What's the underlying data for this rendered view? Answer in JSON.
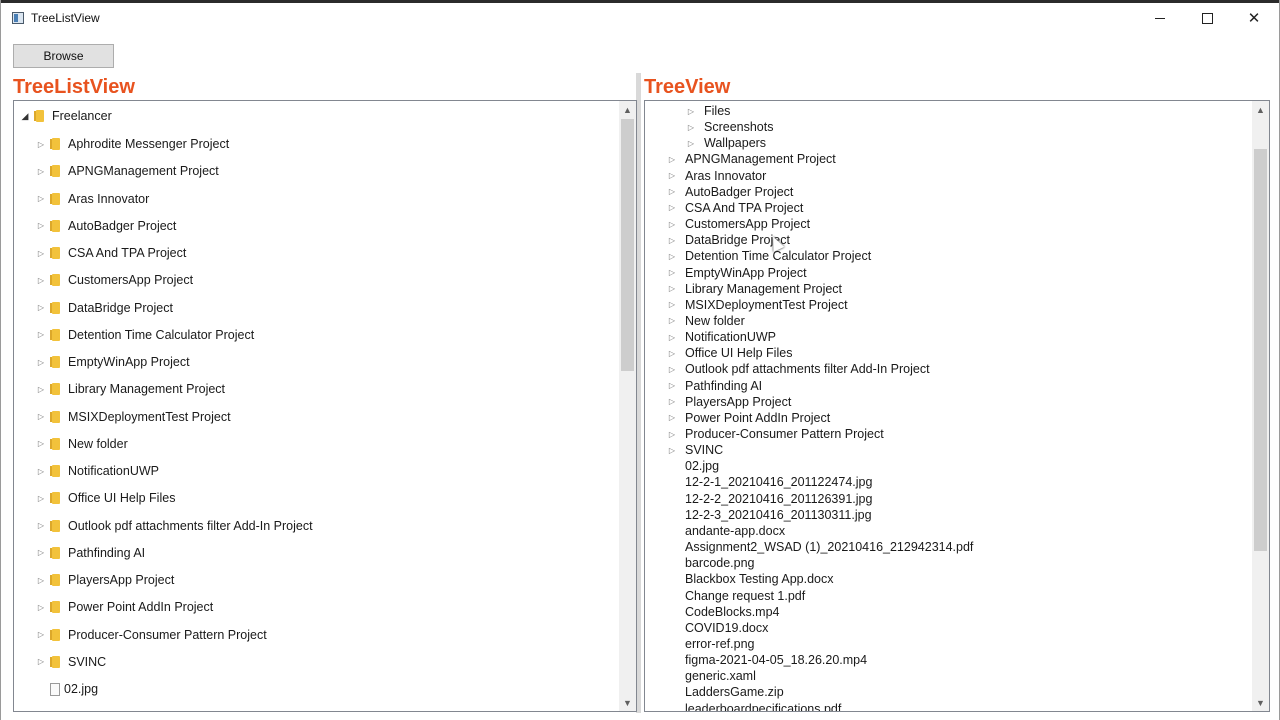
{
  "window": {
    "title": "TreeListView",
    "minimize": "—",
    "maximize": "☐",
    "close": "✕"
  },
  "toolbar": {
    "browse_label": "Browse"
  },
  "left_panel": {
    "heading": "TreeListView",
    "root": "Freelancer",
    "items": [
      {
        "label": "Aphrodite Messenger Project",
        "type": "folder"
      },
      {
        "label": "APNGManagement Project",
        "type": "folder"
      },
      {
        "label": "Aras Innovator",
        "type": "folder"
      },
      {
        "label": "AutoBadger Project",
        "type": "folder"
      },
      {
        "label": "CSA And TPA Project",
        "type": "folder"
      },
      {
        "label": "CustomersApp Project",
        "type": "folder"
      },
      {
        "label": "DataBridge Project",
        "type": "folder"
      },
      {
        "label": "Detention Time Calculator Project",
        "type": "folder"
      },
      {
        "label": "EmptyWinApp Project",
        "type": "folder"
      },
      {
        "label": "Library Management Project",
        "type": "folder"
      },
      {
        "label": "MSIXDeploymentTest Project",
        "type": "folder"
      },
      {
        "label": "New folder",
        "type": "folder"
      },
      {
        "label": "NotificationUWP",
        "type": "folder"
      },
      {
        "label": "Office UI Help Files",
        "type": "folder"
      },
      {
        "label": "Outlook pdf attachments filter Add-In Project",
        "type": "folder"
      },
      {
        "label": "Pathfinding AI",
        "type": "folder"
      },
      {
        "label": "PlayersApp Project",
        "type": "folder"
      },
      {
        "label": "Power Point AddIn Project",
        "type": "folder"
      },
      {
        "label": "Producer-Consumer Pattern Project",
        "type": "folder"
      },
      {
        "label": "SVINC",
        "type": "folder"
      },
      {
        "label": "02.jpg",
        "type": "file"
      }
    ]
  },
  "right_panel": {
    "heading": "TreeView",
    "sub_items": [
      "Files",
      "Screenshots",
      "Wallpapers"
    ],
    "folders": [
      "APNGManagement Project",
      "Aras Innovator",
      "AutoBadger Project",
      "CSA And TPA Project",
      "CustomersApp Project",
      "DataBridge Project",
      "Detention Time Calculator Project",
      "EmptyWinApp Project",
      "Library Management Project",
      "MSIXDeploymentTest Project",
      "New folder",
      "NotificationUWP",
      "Office UI Help Files",
      "Outlook pdf attachments filter Add-In Project",
      "Pathfinding AI",
      "PlayersApp Project",
      "Power Point AddIn Project",
      "Producer-Consumer Pattern Project",
      "SVINC"
    ],
    "files": [
      "02.jpg",
      "12-2-1_20210416_201122474.jpg",
      "12-2-2_20210416_201126391.jpg",
      "12-2-3_20210416_201130311.jpg",
      "andante-app.docx",
      "Assignment2_WSAD (1)_20210416_212942314.pdf",
      "barcode.png",
      "Blackbox Testing App.docx",
      "Change request 1.pdf",
      "CodeBlocks.mp4",
      "COVID19.docx",
      "error-ref.png",
      "figma-2021-04-05_18.26.20.mp4",
      "generic.xaml",
      "LaddersGame.zip",
      "leaderboardpecifications.pdf"
    ]
  },
  "colors": {
    "heading": "#e8531f",
    "folder": "#f2c23b",
    "panel_border": "#828790"
  }
}
